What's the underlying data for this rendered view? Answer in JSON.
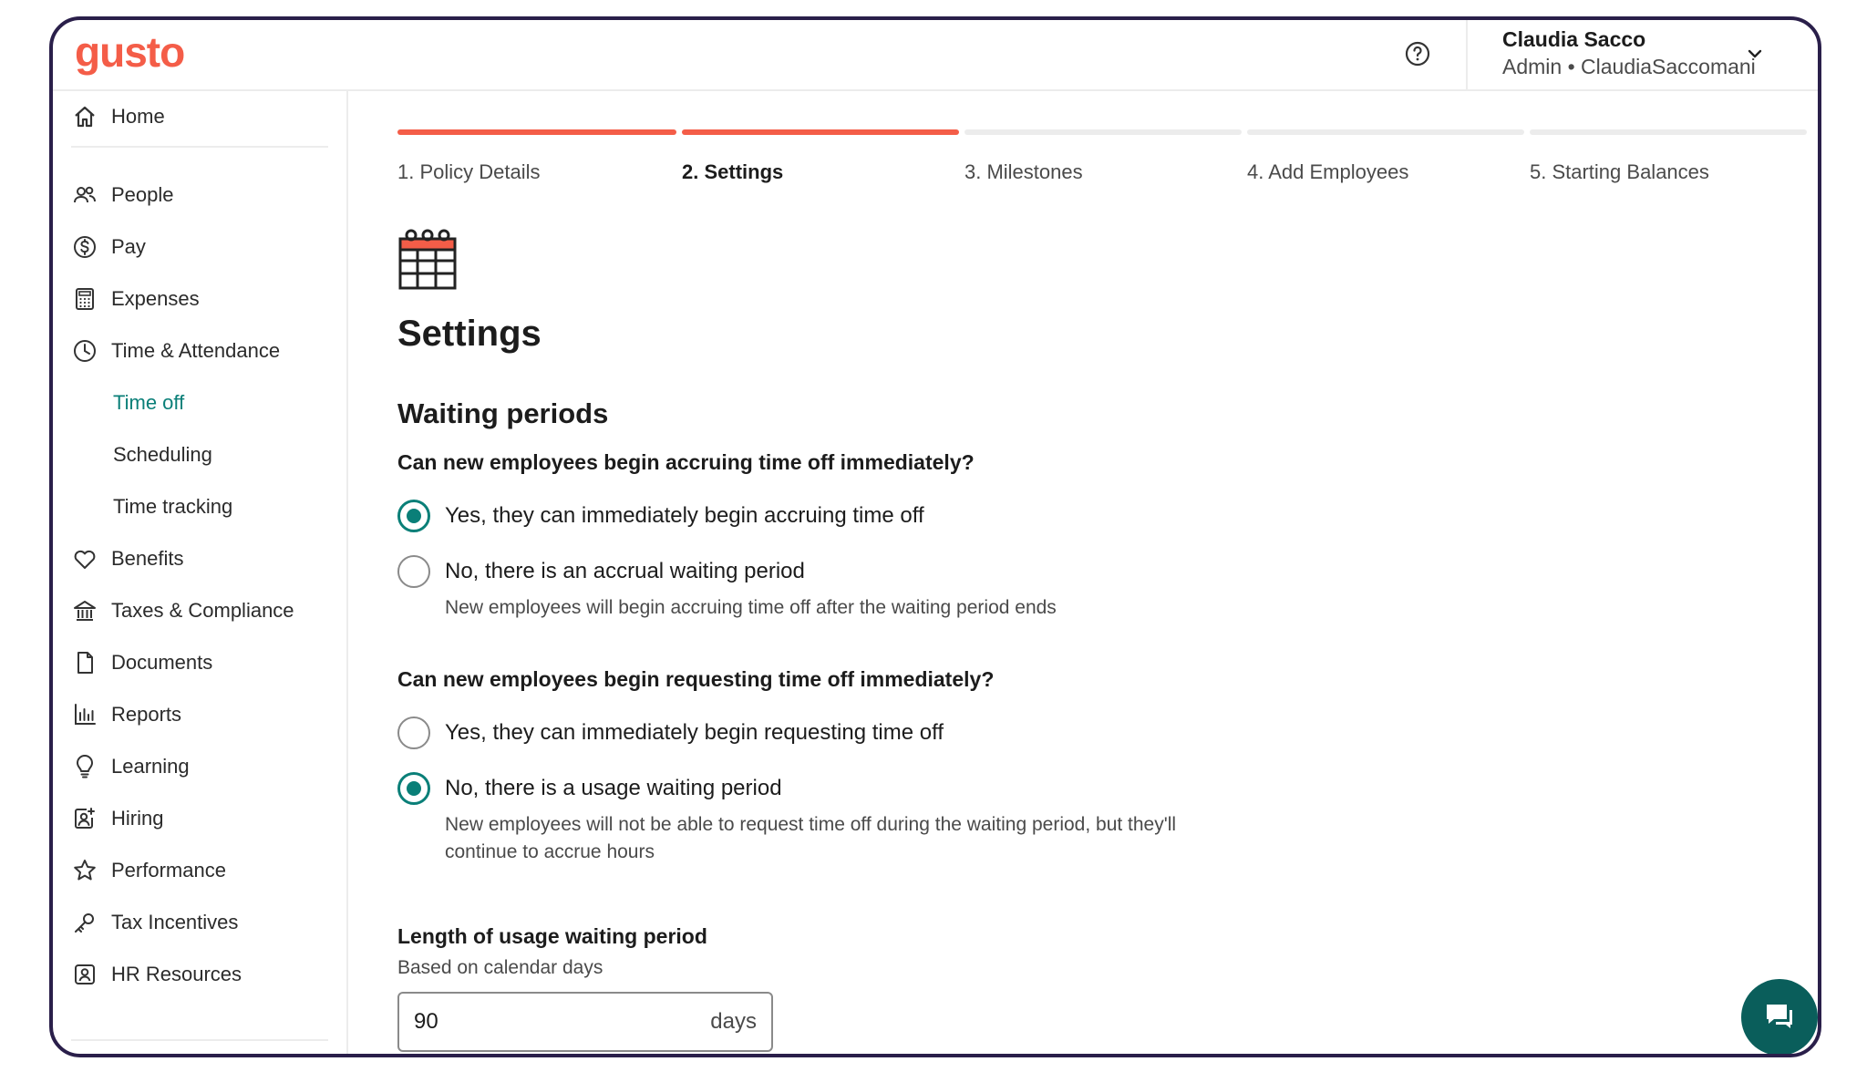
{
  "brand": {
    "logo": "gusto",
    "accent": "#f45d48",
    "teal": "#0a7f78"
  },
  "header": {
    "user_name": "Claudia Sacco",
    "user_sub": "Admin • ClaudiaSaccomani"
  },
  "sidebar": {
    "items": [
      {
        "label": "Home",
        "icon": "home-icon"
      },
      {
        "label": "People",
        "icon": "people-icon"
      },
      {
        "label": "Pay",
        "icon": "dollar-icon"
      },
      {
        "label": "Expenses",
        "icon": "calculator-icon"
      },
      {
        "label": "Time & Attendance",
        "icon": "clock-icon"
      },
      {
        "label": "Time off"
      },
      {
        "label": "Scheduling"
      },
      {
        "label": "Time tracking"
      },
      {
        "label": "Benefits",
        "icon": "heart-icon"
      },
      {
        "label": "Taxes & Compliance",
        "icon": "bank-icon"
      },
      {
        "label": "Documents",
        "icon": "document-icon"
      },
      {
        "label": "Reports",
        "icon": "bar-chart-icon"
      },
      {
        "label": "Learning",
        "icon": "lightbulb-icon"
      },
      {
        "label": "Hiring",
        "icon": "hiring-icon"
      },
      {
        "label": "Performance",
        "icon": "star-icon"
      },
      {
        "label": "Tax Incentives",
        "icon": "key-icon"
      },
      {
        "label": "HR Resources",
        "icon": "hr-icon"
      }
    ],
    "active": "Time off"
  },
  "steps": [
    {
      "label": "1. Policy Details",
      "status": "done"
    },
    {
      "label": "2. Settings",
      "status": "current"
    },
    {
      "label": "3. Milestones",
      "status": "todo"
    },
    {
      "label": "4. Add Employees",
      "status": "todo"
    },
    {
      "label": "5. Starting Balances",
      "status": "todo"
    }
  ],
  "page": {
    "title": "Settings",
    "section": "Waiting periods",
    "q1": {
      "question": "Can new employees begin accruing time off immediately?",
      "options": [
        {
          "label": "Yes, they can immediately begin accruing time off",
          "checked": true
        },
        {
          "label": "No, there is an accrual waiting period",
          "help": "New employees will begin accruing time off after the waiting period ends",
          "checked": false
        }
      ]
    },
    "q2": {
      "question": "Can new employees begin requesting time off immediately?",
      "options": [
        {
          "label": "Yes, they can immediately begin requesting time off",
          "checked": false
        },
        {
          "label": "No, there is a usage waiting period",
          "help_line1": "New employees will not be able to request time off during the waiting period, but they'll",
          "help_line2": "continue to accrue hours",
          "checked": true
        }
      ]
    },
    "field": {
      "label": "Length of usage waiting period",
      "sub": "Based on calendar days",
      "value": "90",
      "unit": "days"
    }
  }
}
